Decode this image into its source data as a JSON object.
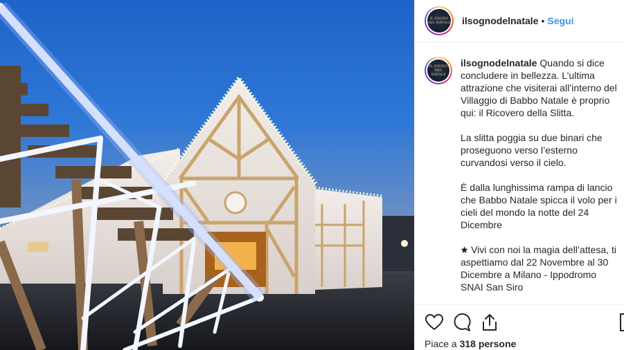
{
  "post": {
    "username": "ilsognodelnatale",
    "separator": "•",
    "follow_label": "Segui",
    "avatar_text_line1": "IL SOGNO",
    "avatar_text_line2": "DEL NATALE"
  },
  "caption": {
    "username": "ilsognodelnatale",
    "paragraphs": [
      "Quando si dice concludere in bellezza. L’ultima attrazione che visiterai all’interno del Villaggio di Babbo Natale è proprio qui: il Ricovero della Slitta.",
      "La slitta poggia su due binari che proseguono verso l’esterno curvandosi verso il cielo.",
      "È dalla lunghissima rampa di lancio che Babbo Natale spicca il volo per i cieli del mondo la notte del 24 Dicembre",
      "🟊 Vivi con noi la magia dell’attesa, ti aspettiamo dal 22 Novembre al 30 Dicembre a Milano - Ippodromo SNAI San Siro"
    ]
  },
  "actions": {
    "like_icon": "heart-icon",
    "comment_icon": "comment-icon",
    "share_icon": "share-icon",
    "save_icon": "bookmark-icon",
    "likes_prefix": "Piace a ",
    "likes_count": "318 persone"
  },
  "colors": {
    "link": "#3897f0",
    "text": "#262626",
    "border": "#efefef"
  }
}
